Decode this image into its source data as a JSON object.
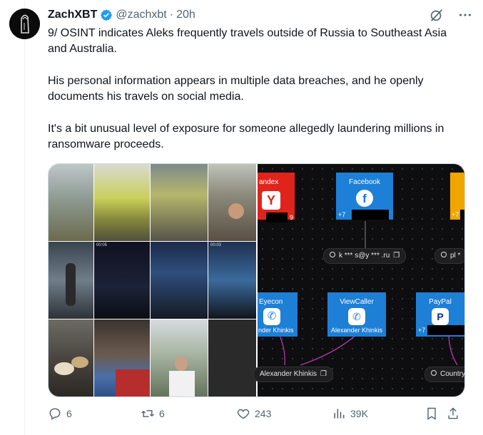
{
  "tweet": {
    "author_name": "ZachXBT",
    "handle": "@zachxbt",
    "separator": "·",
    "time": "20h",
    "paragraphs": [
      "9/ OSINT indicates Aleks frequently travels outside of Russia to Southeast Asia and Australia.",
      "His personal information appears in multiple data breaches, and he openly documents his travels on social media.",
      "It's a bit unusual level of exposure for someone allegedly laundering millions in ransomware proceeds."
    ]
  },
  "diagram": {
    "nodes": [
      {
        "title": "andex",
        "label": "9",
        "color": "#e0241c"
      },
      {
        "title": "Facebook",
        "label": "+7",
        "color": "#1d7fd6"
      },
      {
        "title": "",
        "label": "+7",
        "color": "#f0a500"
      },
      {
        "title": "Eyecon",
        "label": "nder Khinkis",
        "color": "#1d7fd6"
      },
      {
        "title": "ViewCaller",
        "label": "Alexander Khinkis",
        "color": "#1d7fd6"
      },
      {
        "title": "PayPal",
        "label": "+7",
        "color": "#1d7fd6"
      }
    ],
    "pills": [
      {
        "text": "k *** s@y *** .ru"
      },
      {
        "text": "pl *"
      },
      {
        "text": "Alexander Khinkis"
      },
      {
        "text": "Country"
      }
    ],
    "video_badges": [
      "00:05",
      "00:03"
    ]
  },
  "actions": {
    "replies": "6",
    "reposts": "6",
    "likes": "243",
    "views": "39K"
  },
  "colors": {
    "text": "#0f1419",
    "secondary": "#536471",
    "verified": "#1d9bf0",
    "node_blue": "#1d7fd6"
  }
}
